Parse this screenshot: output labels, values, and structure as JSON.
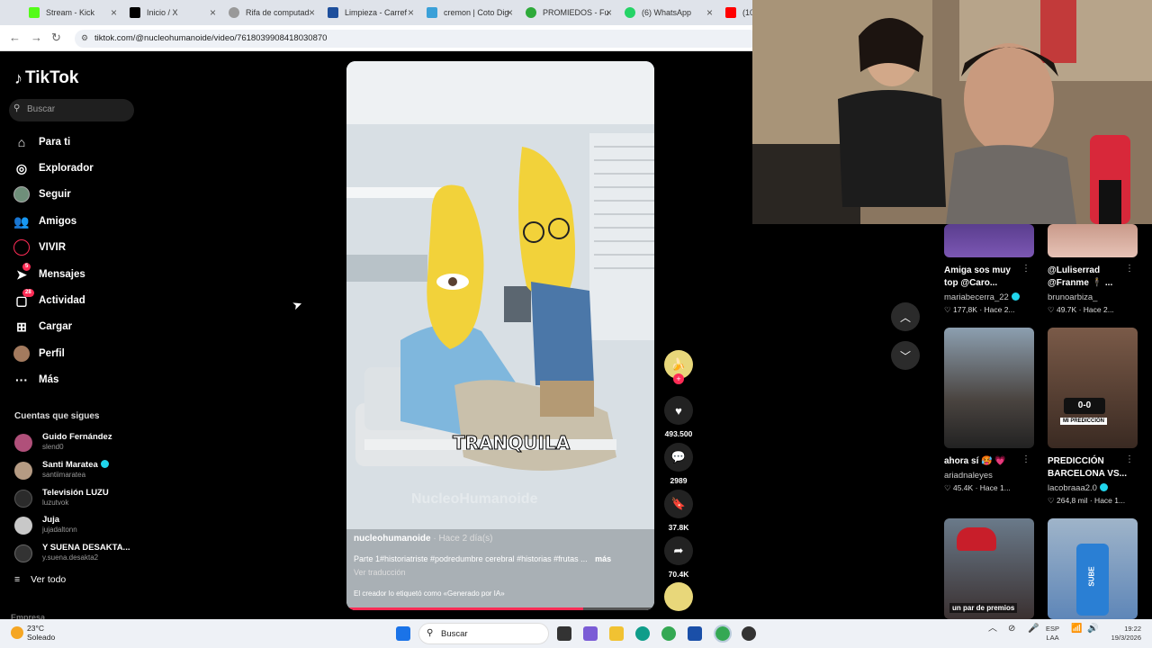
{
  "browser": {
    "tabs": [
      {
        "label": "Stream - Kick",
        "color": "#53fc18"
      },
      {
        "label": "Inicio / X",
        "color": "#000000"
      },
      {
        "label": "Rifa de computad",
        "color": "#888888"
      },
      {
        "label": "Limpieza - Carref",
        "color": "#1e4f9c"
      },
      {
        "label": "cremon | Coto Dig",
        "color": "#3aa0d8"
      },
      {
        "label": "PROMIEDOS - Fu",
        "color": "#2eaa3a"
      },
      {
        "label": "(6) WhatsApp",
        "color": "#25d366"
      },
      {
        "label": "(10",
        "color": "#ff0000"
      }
    ],
    "url": "tiktok.com/@nucleohumanoide/video/7618039908418030870"
  },
  "sidebar": {
    "logo": "TikTok",
    "search_placeholder": "Buscar",
    "nav": [
      {
        "label": "Para ti",
        "icon": "home-icon"
      },
      {
        "label": "Explorador",
        "icon": "compass-icon"
      },
      {
        "label": "Seguir",
        "icon": "following-avatar-icon"
      },
      {
        "label": "Amigos",
        "icon": "friends-icon"
      },
      {
        "label": "VIVIR",
        "icon": "live-icon"
      },
      {
        "label": "Mensajes",
        "icon": "messages-icon",
        "badge": "5"
      },
      {
        "label": "Actividad",
        "icon": "activity-icon",
        "badge": "28"
      },
      {
        "label": "Cargar",
        "icon": "upload-icon"
      },
      {
        "label": "Perfil",
        "icon": "profile-avatar-icon"
      },
      {
        "label": "Más",
        "icon": "more-icon"
      }
    ],
    "following_title": "Cuentas que sigues",
    "following": [
      {
        "name": "Guido Fernández",
        "handle": "slend0",
        "verified": false
      },
      {
        "name": "Santi Maratea",
        "handle": "santiimaratea",
        "verified": true
      },
      {
        "name": "Televisión LUZU",
        "handle": "luzutvok",
        "verified": false
      },
      {
        "name": "Juja",
        "handle": "jujadaltonn",
        "verified": false
      },
      {
        "name": "Y SUENA DESAKTA...",
        "handle": "y.suena.desakta2",
        "verified": false
      }
    ],
    "see_all": "Ver todo",
    "footer": "Empresa"
  },
  "video": {
    "overlay_text": "TRANQUILA",
    "watermark": "NucleoHumanoide",
    "author": "nucleohumanoide",
    "posted": "· Hace 2 día(s)",
    "caption": "Parte 1#historiatriste #podredumbre cerebral #historias #frutas ...",
    "more": "más",
    "translate": "Ver traducción",
    "ai_label": "El creador lo etiquetó como «Generado por IA»",
    "progress": 0.77
  },
  "actions": {
    "likes": "493.500",
    "comments": "2989",
    "saves": "37.8K",
    "shares": "70.4K"
  },
  "feed": [
    {
      "title": "Amiga sos muy top @Caro...",
      "channel": "mariabecerra_22",
      "verified": true,
      "likes": "177,8K",
      "time": "· Hace 2..."
    },
    {
      "title": "@Luliserrad @Franme 🕴 ...",
      "channel": "brunoarbiza_",
      "verified": false,
      "likes": "49.7K",
      "time": "· Hace 2..."
    },
    {
      "title": "ahora sí 🥵 💗",
      "channel": "ariadnaleyes",
      "verified": false,
      "likes": "45.4K",
      "time": "· Hace 1..."
    },
    {
      "title": "PREDICCIÓN BARCELONA VS...",
      "channel": "lacobraaa2.0",
      "verified": true,
      "likes": "264,8 mil",
      "time": "· Hace 1..."
    },
    {
      "thumb_text": "un par de premios"
    },
    {
      "thumb_text": "SUBE"
    }
  ],
  "thumb_labels": {
    "score": "0-0",
    "prediction": "MI PREDICCIÓN"
  },
  "taskbar": {
    "temp": "23°C",
    "weather": "Soleado",
    "search": "Buscar",
    "lang1": "ESP",
    "lang2": "LAA",
    "time": "19:22",
    "date": "19/3/2026"
  }
}
